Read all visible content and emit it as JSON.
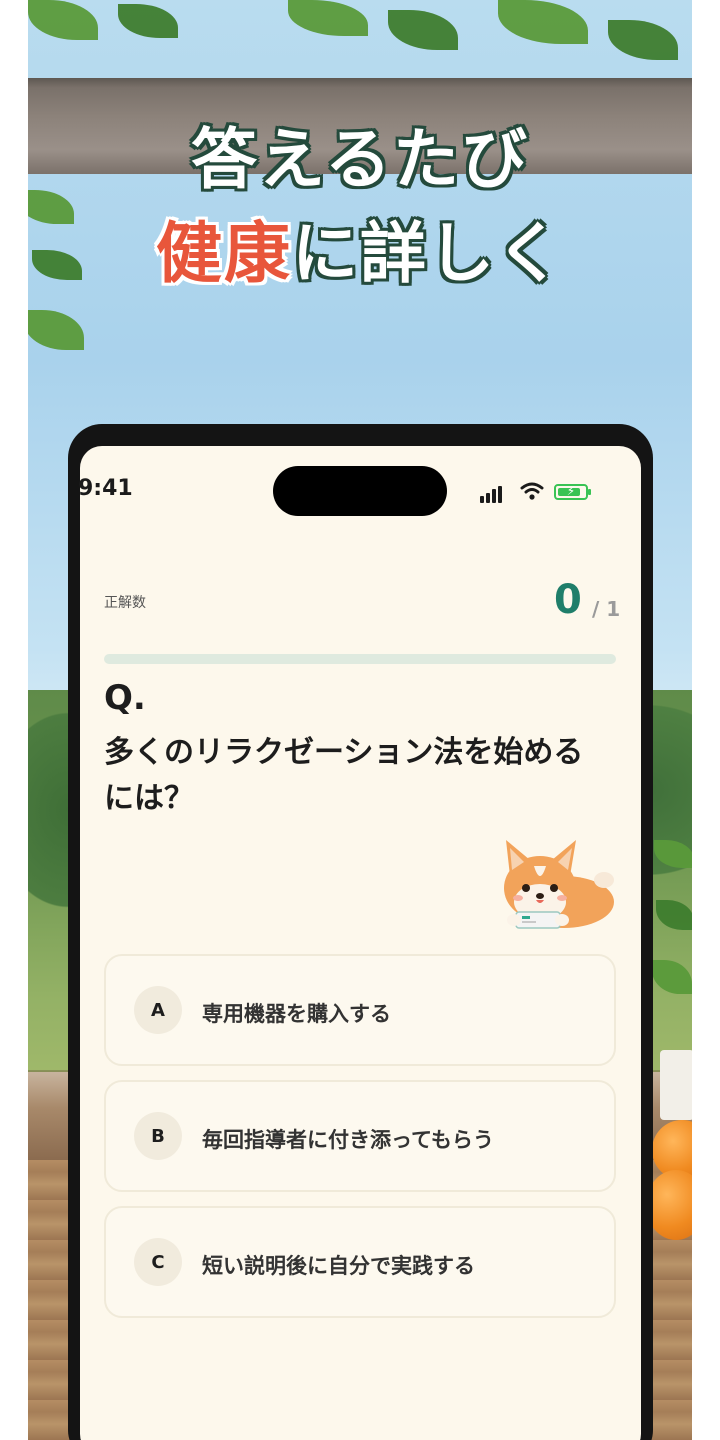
{
  "headline": {
    "line1": "答えるたび",
    "line2_accent": "健康",
    "line2_rest": "に詳しく"
  },
  "status_bar": {
    "time": "9:41",
    "icons": [
      "signal-icon",
      "wifi-icon",
      "battery-charging-icon"
    ]
  },
  "quiz": {
    "score_label": "正解数",
    "score_correct": "0",
    "score_total": "/ 1",
    "progress_fraction": 0,
    "question_prefix": "Q.",
    "question_text": "多くのリラクゼーション法を始めるには？",
    "choices": [
      {
        "key": "A",
        "text": "専用機器を購入する"
      },
      {
        "key": "B",
        "text": "毎回指導者に付き添ってもらう"
      },
      {
        "key": "C",
        "text": "短い説明後に自分で実践する"
      }
    ]
  },
  "colors": {
    "accent": "#e8563b",
    "headline_outline": "#244a3c",
    "score": "#1f7e6a",
    "screen_background": "#fdf8ec"
  },
  "mascot": "corgi-mascot-icon"
}
